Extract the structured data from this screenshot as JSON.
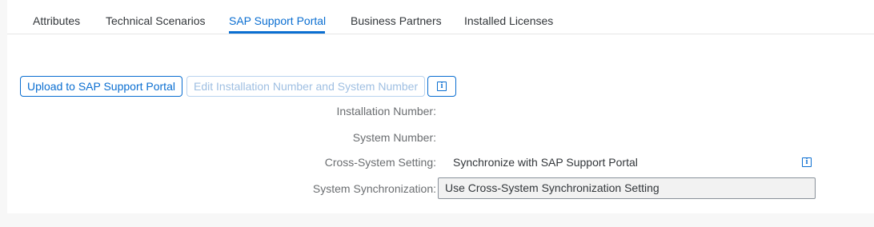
{
  "tabs": [
    {
      "label": "Attributes"
    },
    {
      "label": "Technical Scenarios"
    },
    {
      "label": "SAP Support Portal"
    },
    {
      "label": "Business Partners"
    },
    {
      "label": "Installed Licenses"
    }
  ],
  "active_tab": "SAP Support Portal",
  "toolbar": {
    "upload_label": "Upload to SAP Support Portal",
    "edit_label": "Edit Installation Number and System Number",
    "info_glyph": "i"
  },
  "form": {
    "installation_number_label": "Installation Number:",
    "installation_number_value": "",
    "system_number_label": "System Number:",
    "system_number_value": "",
    "cross_system_label": "Cross-System Setting:",
    "cross_system_value": "Synchronize with SAP Support Portal",
    "sync_label": "System Synchronization:",
    "sync_value": "Use Cross-System Synchronization Setting"
  },
  "icons": {
    "info": "info-icon"
  },
  "colors": {
    "accent": "#0a6ed1",
    "text": "#32363a",
    "label": "#6a6d70",
    "disabled": "#9fbfe2"
  }
}
